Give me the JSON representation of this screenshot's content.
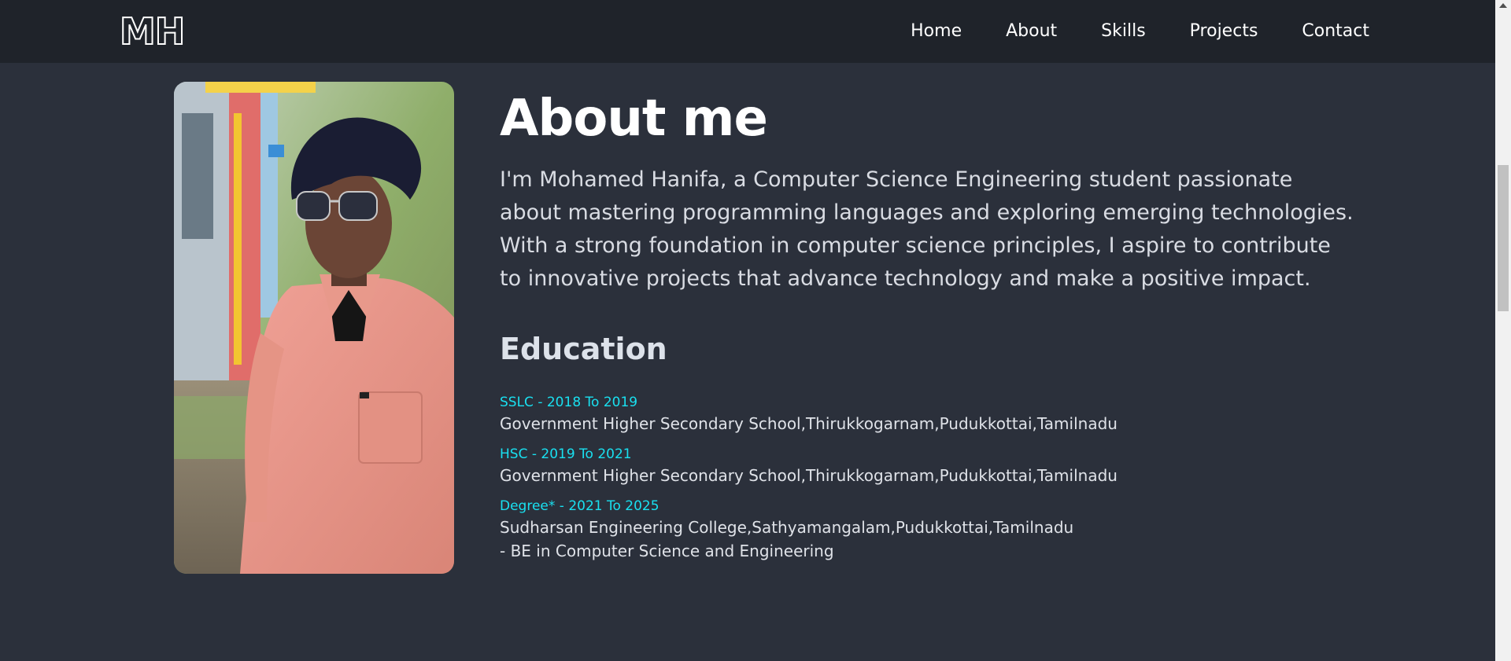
{
  "brand": {
    "logo_text": "MH"
  },
  "nav": {
    "items": [
      {
        "label": "Home"
      },
      {
        "label": "About"
      },
      {
        "label": "Skills"
      },
      {
        "label": "Projects"
      },
      {
        "label": "Contact"
      }
    ]
  },
  "about": {
    "title": "About me",
    "intro": "I'm Mohamed Hanifa, a Computer Science Engineering student passionate about mastering programming languages and exploring emerging technologies. With a strong foundation in computer science principles, I aspire to contribute to innovative projects that advance technology and make a positive impact."
  },
  "education": {
    "title": "Education",
    "items": [
      {
        "label": "SSLC - 2018 To 2019",
        "detail": "Government Higher Secondary School,Thirukkogarnam,Pudukkottai,Tamilnadu",
        "extra": ""
      },
      {
        "label": "HSC - 2019 To 2021",
        "detail": "Government Higher Secondary School,Thirukkogarnam,Pudukkottai,Tamilnadu",
        "extra": ""
      },
      {
        "label": "Degree* - 2021 To 2025",
        "detail": "Sudharsan Engineering College,Sathyamangalam,Pudukkottai,Tamilnadu",
        "extra": "- BE in Computer Science and Engineering"
      }
    ]
  },
  "colors": {
    "background": "#2b303b",
    "navbar": "#1f232a",
    "accent": "#19e0f0"
  }
}
